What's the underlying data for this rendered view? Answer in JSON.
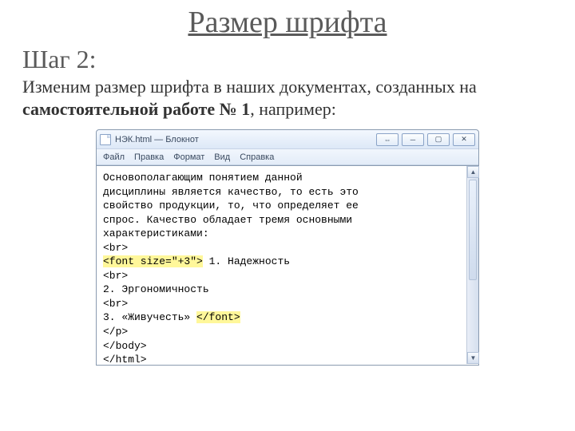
{
  "slide": {
    "title": "Размер шрифта",
    "step_label": "Шаг 2:",
    "body_pre": "Изменим размер шрифта в наших документах, созданных на ",
    "body_bold": "самостоятельной работе № 1",
    "body_post": ", например:"
  },
  "notepad": {
    "title": "НЭК.html — Блокнот",
    "menu": {
      "file": "Файл",
      "edit": "Правка",
      "format": "Формат",
      "view": "Вид",
      "help": "Справка"
    },
    "buttons": {
      "ext": "⇔",
      "min": "─",
      "max": "▢",
      "close": "✕"
    },
    "scrollbar": {
      "up": "▲",
      "down": "▼"
    },
    "code": {
      "l1": "Основополагающим понятием данной",
      "l2": "дисциплины является качество, то есть это",
      "l3": "свойство продукции, то, что определяет ее",
      "l4": "спрос. Качество обладает тремя основными",
      "l5": "характеристиками:",
      "l6": "<br>",
      "l7a": "<font size=\"+3\">",
      "l7b": " 1. Надежность",
      "l8": "<br>",
      "l9": "2. Эргономичность",
      "l10": "<br>",
      "l11a": "3. «Живучесть» ",
      "l11b": "</font>",
      "l12": "</p>",
      "l13": "</body>",
      "l14": "</html>"
    }
  }
}
